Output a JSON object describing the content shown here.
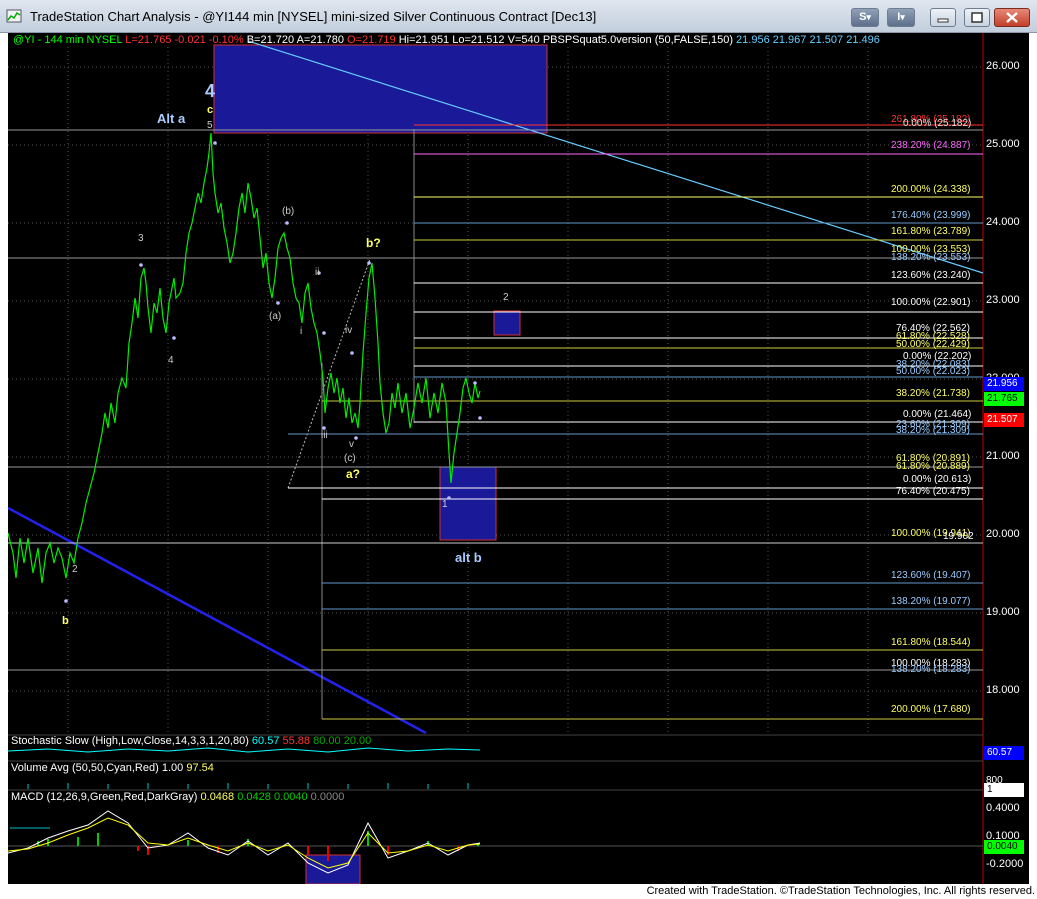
{
  "window": {
    "title": "TradeStation Chart Analysis - @YI144 min [NYSEL] mini-sized Silver Continuous Contract [Dec13]",
    "s_button": "S",
    "i_button": "I",
    "dropdown_glyph": "▾"
  },
  "status_line": {
    "symbol": "@YI - 144 min",
    "exchange": "NYSEL",
    "last": "L=21.765",
    "change": "-0.021",
    "change_pct": "-0.10%",
    "bid": "B=21.720",
    "ask": "A=21.780",
    "open": "O=21.719",
    "high": "Hi=21.951",
    "low": "Lo=21.512",
    "volume": "V=540",
    "indicator": "PBSPSquat5.0version (50,FALSE,150)",
    "ind_values": [
      "21.956",
      "21.967",
      "21.507",
      "21.496"
    ]
  },
  "price_axis": {
    "ticks": [
      "26.000",
      "25.000",
      "24.000",
      "23.000",
      "22.000",
      "21.000",
      "20.000",
      "19.000",
      "18.000"
    ],
    "flags": [
      {
        "text": "21.956",
        "bg": "#0000ff",
        "fg": "#ffffff"
      },
      {
        "text": "21.765",
        "bg": "#00ff00",
        "fg": "#000000"
      },
      {
        "text": "21.507",
        "bg": "#ff0000",
        "fg": "#ffffff"
      }
    ]
  },
  "fib_labels": [
    {
      "text": "261.80% (25.182)",
      "color": "#ff3333"
    },
    {
      "text": "0.00% (25.182)",
      "color": "#e0e0e0"
    },
    {
      "text": "238.20% (24.887)",
      "color": "#ff66ff"
    },
    {
      "text": "200.00% (24.338)",
      "color": "#ffff66"
    },
    {
      "text": "176.40% (23.999)",
      "color": "#99ccff"
    },
    {
      "text": "161.80% (23.789)",
      "color": "#ffff66"
    },
    {
      "text": "100.00% (23.553)",
      "color": "#ffff66"
    },
    {
      "text": "138.20% (23.553)",
      "color": "#99ccff"
    },
    {
      "text": "123.60% (23.240)",
      "color": "#ffffff"
    },
    {
      "text": "100.00% (22.901)",
      "color": "#ffffff"
    },
    {
      "text": "76.40% (22.562)",
      "color": "#ffffff"
    },
    {
      "text": "61.80% (22.528)",
      "color": "#ffff66"
    },
    {
      "text": "50.00% (22.429)",
      "color": "#ffff66"
    },
    {
      "text": "0.00% (22.202)",
      "color": "#ffffff"
    },
    {
      "text": "38.20% (22.083)",
      "color": "#99ccff"
    },
    {
      "text": "50.00% (22.023)",
      "color": "#99ccff"
    },
    {
      "text": "38.20% (21.738)",
      "color": "#ffff66"
    },
    {
      "text": "0.00% (21.464)",
      "color": "#ffffff"
    },
    {
      "text": "23.60% (21.309)",
      "color": "#99ccff"
    },
    {
      "text": "38.20% (21.309)",
      "color": "#99ccff"
    },
    {
      "text": "61.80% (20.891)",
      "color": "#ffff66"
    },
    {
      "text": "61.80% (20.889)",
      "color": "#ffff66"
    },
    {
      "text": "0.00% (20.613)",
      "color": "#ffffff"
    },
    {
      "text": "76.40% (20.475)",
      "color": "#ffffff"
    },
    {
      "text": "100.00% (19.941)",
      "color": "#ffff66"
    },
    {
      "text": "19.902",
      "color": "#ffffff"
    },
    {
      "text": "123.60% (19.407)",
      "color": "#99ccff"
    },
    {
      "text": "138.20% (19.077)",
      "color": "#99ccff"
    },
    {
      "text": "161.80% (18.544)",
      "color": "#ffff66"
    },
    {
      "text": "100.00% (18.283)",
      "color": "#ffffff"
    },
    {
      "text": "138.20% (18.283)",
      "color": "#99ccff"
    },
    {
      "text": "200.00% (17.680)",
      "color": "#ffff66"
    }
  ],
  "wave_labels": {
    "w4": "4",
    "wc": "c",
    "w5": "5",
    "alt_a": "Alt a",
    "w3": "3",
    "w4b": "4",
    "w2": "2",
    "wb": "b",
    "wb_paren": "(b)",
    "wa_paren": "(a)",
    "wii": "ii",
    "wi": "i",
    "wiii": "iii",
    "wiv": "iv",
    "wv": "v",
    "wc_paren": "(c)",
    "wa_q": "a?",
    "wb_q": "b?",
    "w2_target": "2",
    "w1": "1",
    "alt_b": "alt b"
  },
  "subgraphs": {
    "stochastic": {
      "label": "Stochastic Slow (High,Low,Close,14,3,3,1,20,80)",
      "values": [
        "60.57",
        "55.88",
        "80.00",
        "20.00"
      ],
      "axis": "60.57"
    },
    "volume": {
      "label": "Volume Avg (50,50,Cyan,Red)",
      "values": [
        "1.00",
        "97.54"
      ],
      "axis_top": "800",
      "axis_flag": "1"
    },
    "macd": {
      "label": "MACD (12,26,9,Green,Red,DarkGray)",
      "values": [
        "0.0468",
        "0.0428",
        "0.0040",
        "0.0000"
      ],
      "ticks": [
        "0.4000",
        "0.1000",
        "0.0040",
        "-0.2000"
      ]
    }
  },
  "footer": "Created with TradeStation. ©TradeStation Technologies, Inc. All rights reserved."
}
